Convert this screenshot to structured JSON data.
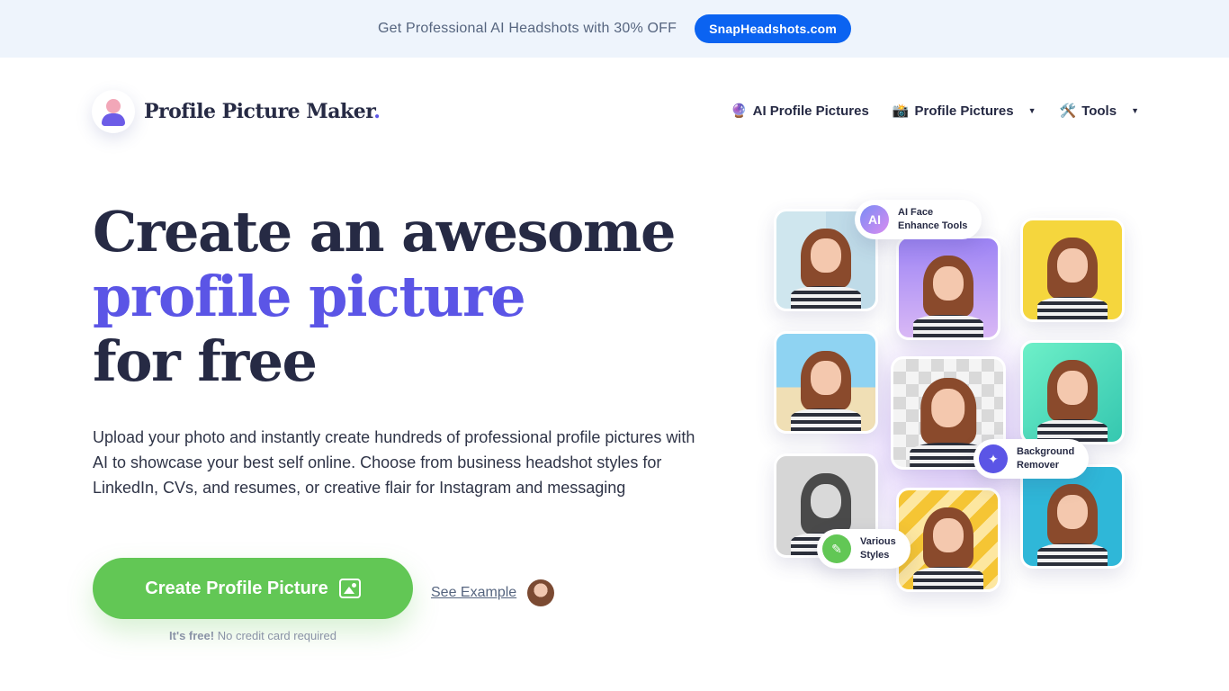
{
  "promo": {
    "text": "Get Professional AI Headshots with 30% OFF",
    "button": "SnapHeadshots.com"
  },
  "header": {
    "logo_text": "Profile Picture Maker",
    "logo_dot": ".",
    "nav": [
      {
        "emoji": "🔮",
        "label": "AI Profile Pictures",
        "caret": ""
      },
      {
        "emoji": "📸",
        "label": "Profile Pictures",
        "caret": "▼"
      },
      {
        "emoji": "🛠️",
        "label": "Tools",
        "caret": "▼"
      }
    ]
  },
  "hero": {
    "title_line1": "Create an awesome",
    "title_line2": "profile picture",
    "title_line3": "for free",
    "description": "Upload your photo and instantly create hundreds of professional profile pictures with AI to showcase your best self online. Choose from business headshot styles for LinkedIn, CVs, and resumes, or creative flair for Instagram and messaging",
    "cta_label": "Create Profile Picture",
    "see_example": "See Example",
    "free_bold": "It's free!",
    "free_rest": " No credit card required"
  },
  "collage": {
    "badges": [
      {
        "icon": "AI",
        "line1": "AI Face",
        "line2": "Enhance Tools",
        "color": "#a58cf2"
      },
      {
        "icon": "✦",
        "line1": "Background",
        "line2": "Remover",
        "color": "#5b55e6"
      },
      {
        "icon": "✎",
        "line1": "Various",
        "line2": "Styles",
        "color": "#62c755"
      }
    ]
  },
  "colors": {
    "accent": "#5b55e6",
    "cta": "#62c755",
    "promo_button": "#0b63f1"
  }
}
